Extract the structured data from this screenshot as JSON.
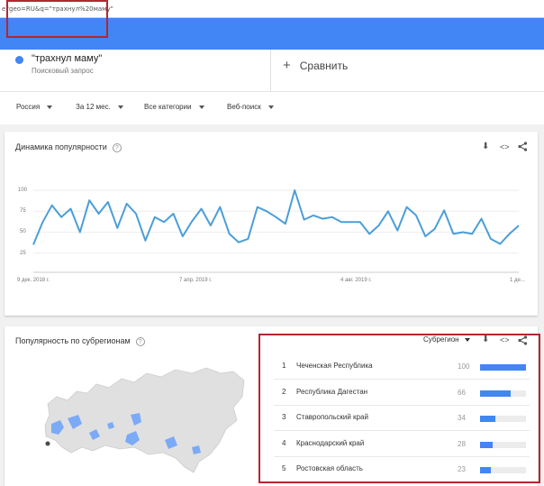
{
  "browser": {
    "url_fragment": "e?geo=RU&q=\"трахнул%20маму\""
  },
  "search_term": {
    "name": "\"трахнул маму\"",
    "type": "Поисковый запрос",
    "color": "#4285f4"
  },
  "compare": {
    "plus": "+",
    "label": "Сравнить"
  },
  "filters": [
    {
      "label": "Россия"
    },
    {
      "label": "За 12 мес."
    },
    {
      "label": "Все категории"
    },
    {
      "label": "Веб-поиск"
    }
  ],
  "interest_over_time": {
    "title": "Динамика популярности",
    "help": "?",
    "icons": {
      "download": "⬇",
      "embed": "<>",
      "share": "share-icon"
    }
  },
  "chart_data": {
    "type": "line",
    "title": "Динамика популярности",
    "y_ticks": [
      "100",
      "75",
      "50",
      "25"
    ],
    "ylim": [
      0,
      100
    ],
    "x_tick_labels": [
      "9 дек. 2018 г.",
      "7 апр. 2019 г.",
      "4 авг. 2019 г.",
      "1 де..."
    ],
    "grid": true,
    "series": [
      {
        "color": "#4b9ed8",
        "values": [
          35,
          62,
          82,
          68,
          78,
          50,
          88,
          72,
          86,
          55,
          84,
          72,
          40,
          68,
          62,
          72,
          45,
          63,
          78,
          58,
          80,
          48,
          38,
          42,
          80,
          75,
          68,
          60,
          100,
          65,
          70,
          66,
          68,
          62,
          62,
          62,
          48,
          58,
          75,
          52,
          80,
          70,
          45,
          54,
          76,
          48,
          50,
          48,
          66,
          42,
          36,
          48,
          58
        ]
      }
    ]
  },
  "interest_by_subregion": {
    "title": "Популярность по субрегионам",
    "help": "?",
    "dropdown_label": "Субрегион",
    "icons": {
      "download": "⬇",
      "embed": "<>",
      "share": "share-icon"
    },
    "map_colors": {
      "land": "#e0e0e0",
      "highlight": "#7baaf7"
    },
    "rows": [
      {
        "rank": "1",
        "name": "Чеченская Республика",
        "value": "100",
        "fraction": 1.0
      },
      {
        "rank": "2",
        "name": "Республика Дагестан",
        "value": "66",
        "fraction": 0.66
      },
      {
        "rank": "3",
        "name": "Ставропольский край",
        "value": "34",
        "fraction": 0.34
      },
      {
        "rank": "4",
        "name": "Краснодарский край",
        "value": "28",
        "fraction": 0.28
      },
      {
        "rank": "5",
        "name": "Ростовская область",
        "value": "23",
        "fraction": 0.23
      }
    ]
  }
}
